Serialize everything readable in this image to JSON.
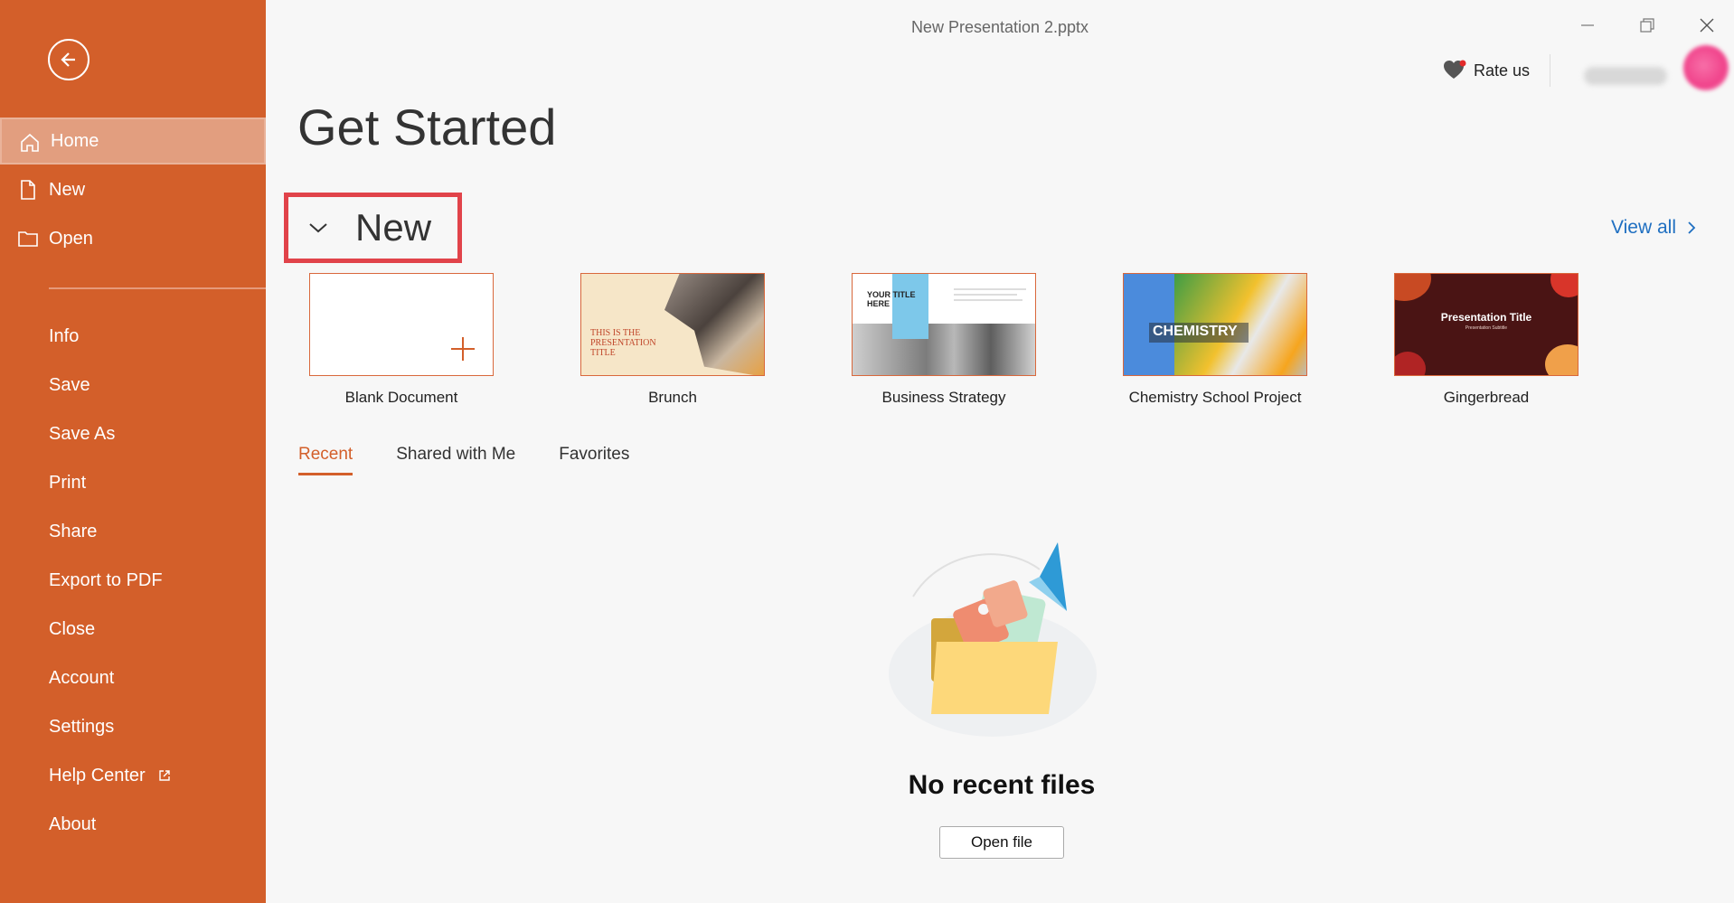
{
  "window": {
    "title": "New Presentation 2.pptx"
  },
  "header": {
    "rate_us": "Rate us"
  },
  "sidebar": {
    "items": [
      {
        "label": "Home",
        "icon": "home-icon",
        "active": true
      },
      {
        "label": "New",
        "icon": "document-icon"
      },
      {
        "label": "Open",
        "icon": "folder-icon"
      },
      {
        "label": "Info"
      },
      {
        "label": "Save"
      },
      {
        "label": "Save As"
      },
      {
        "label": "Print"
      },
      {
        "label": "Share"
      },
      {
        "label": "Export to PDF"
      },
      {
        "label": "Close"
      },
      {
        "label": "Account"
      },
      {
        "label": "Settings"
      },
      {
        "label": "Help Center",
        "icon": "external-link-icon"
      },
      {
        "label": "About"
      }
    ]
  },
  "main": {
    "title": "Get Started",
    "new_section": {
      "label": "New",
      "view_all": "View all"
    },
    "templates": [
      {
        "name": "Blank Document"
      },
      {
        "name": "Brunch",
        "thumb_text": "THIS IS THE PRESENTATION TITLE"
      },
      {
        "name": "Business Strategy",
        "thumb_text": "YOUR TITLE HERE"
      },
      {
        "name": "Chemistry School Project",
        "thumb_text": "CHEMISTRY"
      },
      {
        "name": "Gingerbread",
        "thumb_text": "Presentation Title",
        "thumb_subtext": "Presentation Subtitle"
      }
    ],
    "tabs": [
      "Recent",
      "Shared with Me",
      "Favorites"
    ],
    "empty_state": {
      "title": "No recent files",
      "button": "Open file"
    }
  },
  "colors": {
    "accent": "#d35f2a",
    "highlight_box": "#e1434a",
    "link": "#1f6fc1"
  }
}
